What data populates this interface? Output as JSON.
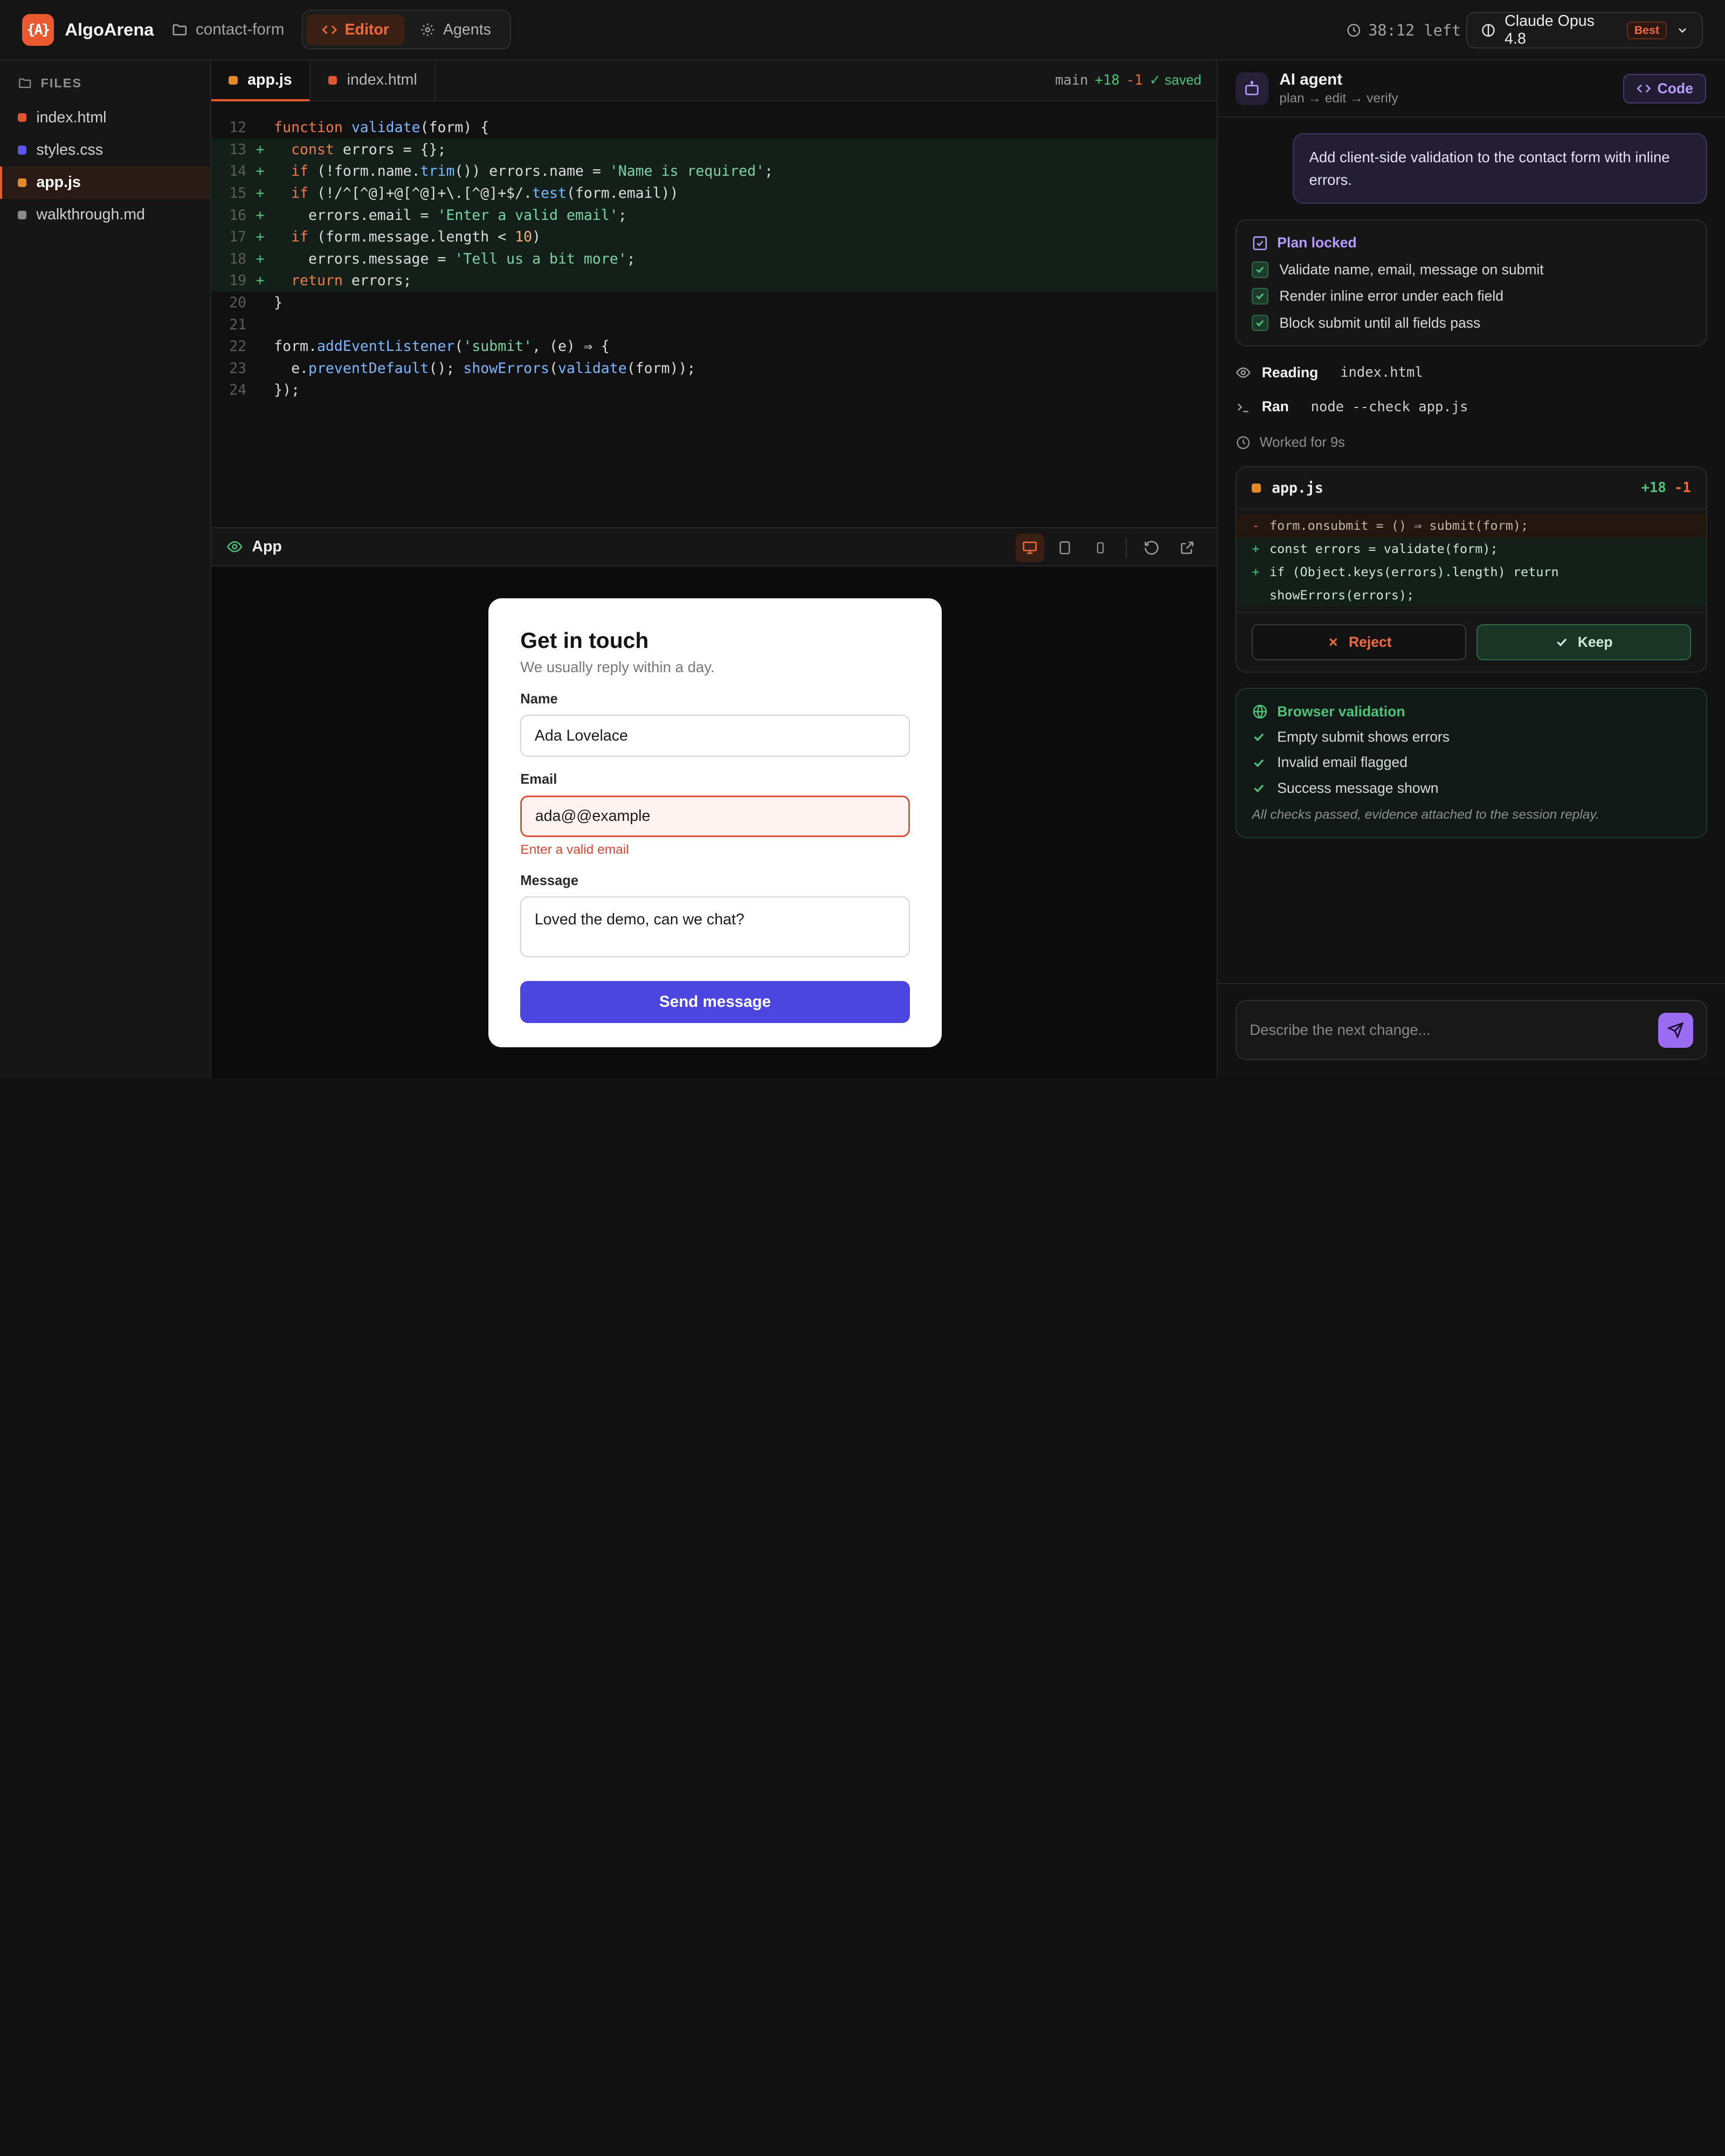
{
  "header": {
    "logo_text": "{A}",
    "brand": "AlgoArena",
    "project": "contact-form",
    "modes": [
      {
        "label": "Editor",
        "active": true
      },
      {
        "label": "Agents",
        "active": false
      }
    ],
    "timer": "38:12 left",
    "model": "Claude Opus 4.8",
    "model_badge": "Best"
  },
  "sidebar": {
    "title": "FILES",
    "files": [
      {
        "name": "index.html",
        "color": "#e2552f",
        "active": false
      },
      {
        "name": "styles.css",
        "color": "#5b55e8",
        "active": false
      },
      {
        "name": "app.js",
        "color": "#e08a2c",
        "active": true
      },
      {
        "name": "walkthrough.md",
        "color": "#8a8a8a",
        "active": false
      }
    ]
  },
  "editor": {
    "tabs": [
      {
        "name": "app.js",
        "color": "#e08a2c",
        "active": true
      },
      {
        "name": "index.html",
        "color": "#e2552f",
        "active": false
      }
    ],
    "branch": "main",
    "additions": "+18",
    "deletions": "-1",
    "saved": "✓ saved",
    "lines": [
      {
        "n": "12",
        "mark": "",
        "added": false,
        "tokens": [
          [
            "k",
            "function "
          ],
          [
            "f",
            "validate"
          ],
          [
            "c",
            "(form) {"
          ]
        ]
      },
      {
        "n": "13",
        "mark": "+",
        "added": true,
        "tokens": [
          [
            "c",
            "  "
          ],
          [
            "k",
            "const "
          ],
          [
            "c",
            "errors = {};"
          ]
        ]
      },
      {
        "n": "14",
        "mark": "+",
        "added": true,
        "tokens": [
          [
            "c",
            "  "
          ],
          [
            "k",
            "if "
          ],
          [
            "c",
            "(!form.name."
          ],
          [
            "f",
            "trim"
          ],
          [
            "c",
            "()) errors.name = "
          ],
          [
            "s",
            "'Name is required'"
          ],
          [
            "c",
            ";"
          ]
        ]
      },
      {
        "n": "15",
        "mark": "+",
        "added": true,
        "tokens": [
          [
            "c",
            "  "
          ],
          [
            "k",
            "if "
          ],
          [
            "c",
            "(!/^[^@]+@[^@]+\\.[^@]+$/."
          ],
          [
            "f",
            "test"
          ],
          [
            "c",
            "(form.email))"
          ]
        ]
      },
      {
        "n": "16",
        "mark": "+",
        "added": true,
        "tokens": [
          [
            "c",
            "    errors.email = "
          ],
          [
            "s",
            "'Enter a valid email'"
          ],
          [
            "c",
            ";"
          ]
        ]
      },
      {
        "n": "17",
        "mark": "+",
        "added": true,
        "tokens": [
          [
            "c",
            "  "
          ],
          [
            "k",
            "if "
          ],
          [
            "c",
            "(form.message.length < "
          ],
          [
            "n",
            "10"
          ],
          [
            "c",
            ")"
          ]
        ]
      },
      {
        "n": "18",
        "mark": "+",
        "added": true,
        "tokens": [
          [
            "c",
            "    errors.message = "
          ],
          [
            "s",
            "'Tell us a bit more'"
          ],
          [
            "c",
            ";"
          ]
        ]
      },
      {
        "n": "19",
        "mark": "+",
        "added": true,
        "tokens": [
          [
            "c",
            "  "
          ],
          [
            "k",
            "return "
          ],
          [
            "c",
            "errors;"
          ]
        ]
      },
      {
        "n": "20",
        "mark": "",
        "added": false,
        "tokens": [
          [
            "c",
            "}"
          ]
        ]
      },
      {
        "n": "21",
        "mark": "",
        "added": false,
        "tokens": [
          [
            "c",
            ""
          ]
        ]
      },
      {
        "n": "22",
        "mark": "",
        "added": false,
        "tokens": [
          [
            "c",
            "form."
          ],
          [
            "f",
            "addEventListener"
          ],
          [
            "c",
            "("
          ],
          [
            "s",
            "'submit'"
          ],
          [
            "c",
            ", (e) ⇒ {"
          ]
        ]
      },
      {
        "n": "23",
        "mark": "",
        "added": false,
        "tokens": [
          [
            "c",
            "  e."
          ],
          [
            "f",
            "preventDefault"
          ],
          [
            "c",
            "(); "
          ],
          [
            "f",
            "showErrors"
          ],
          [
            "c",
            "("
          ],
          [
            "f",
            "validate"
          ],
          [
            "c",
            "(form));"
          ]
        ]
      },
      {
        "n": "24",
        "mark": "",
        "added": false,
        "tokens": [
          [
            "c",
            "});"
          ]
        ]
      }
    ]
  },
  "preview": {
    "title": "App",
    "form": {
      "heading": "Get in touch",
      "subheading": "We usually reply within a day.",
      "name_label": "Name",
      "name_value": "Ada Lovelace",
      "email_label": "Email",
      "email_value": "ada@@example",
      "email_error": "Enter a valid email",
      "message_label": "Message",
      "message_value": "Loved the demo, can we chat?",
      "submit_label": "Send message"
    }
  },
  "agent": {
    "title": "AI agent",
    "subtitle": "plan → edit → verify",
    "code_button": "Code",
    "user_message": "Add client-side validation to the contact form with inline errors.",
    "plan": {
      "title": "Plan locked",
      "items": [
        "Validate name, email, message on submit",
        "Render inline error under each field",
        "Block submit until all fields pass"
      ]
    },
    "steps": [
      {
        "label": "Reading",
        "value": "index.html",
        "icon": "eye-icon"
      },
      {
        "label": "Ran",
        "value": "node --check app.js",
        "icon": "terminal-icon"
      }
    ],
    "worked": "Worked for 9s",
    "diff": {
      "file": "app.js",
      "additions": "+18",
      "deletions": "-1",
      "lines": [
        {
          "type": "del",
          "mark": "-",
          "text": "form.onsubmit = () ⇒ submit(form);"
        },
        {
          "type": "add",
          "mark": "+",
          "text": "const errors = validate(form);"
        },
        {
          "type": "add",
          "mark": "+",
          "text": "if (Object.keys(errors).length) return"
        },
        {
          "type": "add",
          "mark": "",
          "text": "showErrors(errors);"
        }
      ],
      "reject_label": "Reject",
      "keep_label": "Keep"
    },
    "validation": {
      "title": "Browser validation",
      "items": [
        "Empty submit shows errors",
        "Invalid email flagged",
        "Success message shown"
      ],
      "note": "All checks passed, evidence attached to the session replay."
    },
    "composer_placeholder": "Describe the next change..."
  }
}
